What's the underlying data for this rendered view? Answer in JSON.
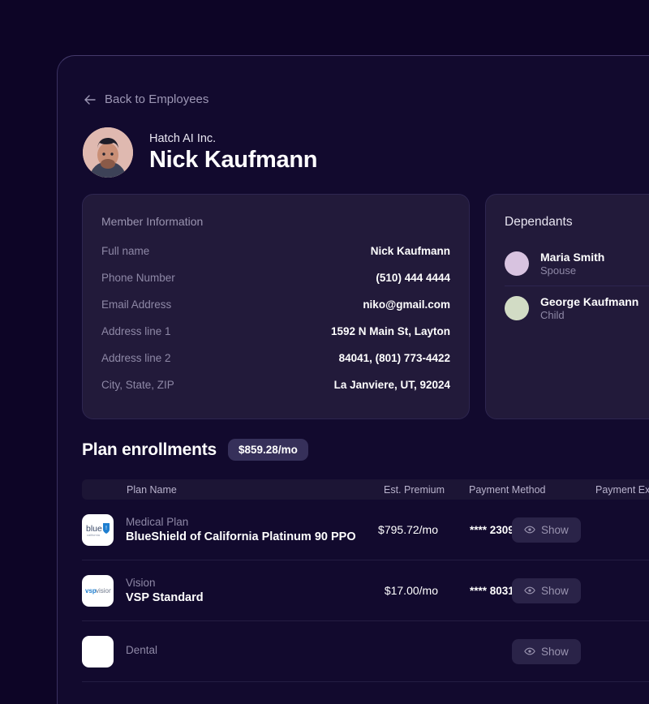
{
  "back_link": {
    "label": "Back to Employees",
    "icon": "arrow-left-icon"
  },
  "profile": {
    "company": "Hatch AI Inc.",
    "name": "Nick Kaufmann",
    "avatar_bg": "#dfb9b0"
  },
  "member_information": {
    "title": "Member Information",
    "rows": [
      {
        "label": "Full name",
        "value": "Nick Kaufmann"
      },
      {
        "label": "Phone Number",
        "value": "(510) 444 4444"
      },
      {
        "label": "Email Address",
        "value": "niko@gmail.com"
      },
      {
        "label": "Address line 1",
        "value": "1592 N Main St, Layton"
      },
      {
        "label": "Address line 2",
        "value": "84041, (801) 773-4422"
      },
      {
        "label": "City, State, ZIP",
        "value": "La Janviere, UT, 92024"
      }
    ]
  },
  "dependants": {
    "title": "Dependants",
    "items": [
      {
        "name": "Maria Smith",
        "relation": "Spouse",
        "color": "#d8c3e0"
      },
      {
        "name": "George Kaufmann",
        "relation": "Child",
        "color": "#d2dcc5"
      }
    ]
  },
  "plan_enrollments": {
    "title": "Plan enrollments",
    "total_badge": "$859.28/mo",
    "columns": {
      "plan_name": "Plan Name",
      "est_premium": "Est. Premium",
      "payment_method": "Payment Method",
      "payment_expected": "Payment Expec"
    },
    "rows": [
      {
        "logo": "blueshield-california-logo",
        "type": "Medical Plan",
        "name": "BlueShield of California Platinum 90 PPO",
        "premium": "$795.72/mo",
        "method": "**** 2309",
        "show_label": "Show"
      },
      {
        "logo": "vsp-vision-logo",
        "type": "Vision",
        "name": "VSP Standard",
        "premium": "$17.00/mo",
        "method": "**** 8031",
        "show_label": "Show"
      },
      {
        "logo": "dental-logo",
        "type": "Dental",
        "name": "",
        "premium": "",
        "method": "",
        "show_label": "Show"
      }
    ]
  },
  "colors": {
    "page_bg": "#0d0526",
    "panel_bg": "#120a2e",
    "card_bg": "#221a3a",
    "badge_bg": "#36305a",
    "accent_text": "#ffffff",
    "muted_text": "#8e88a6"
  }
}
